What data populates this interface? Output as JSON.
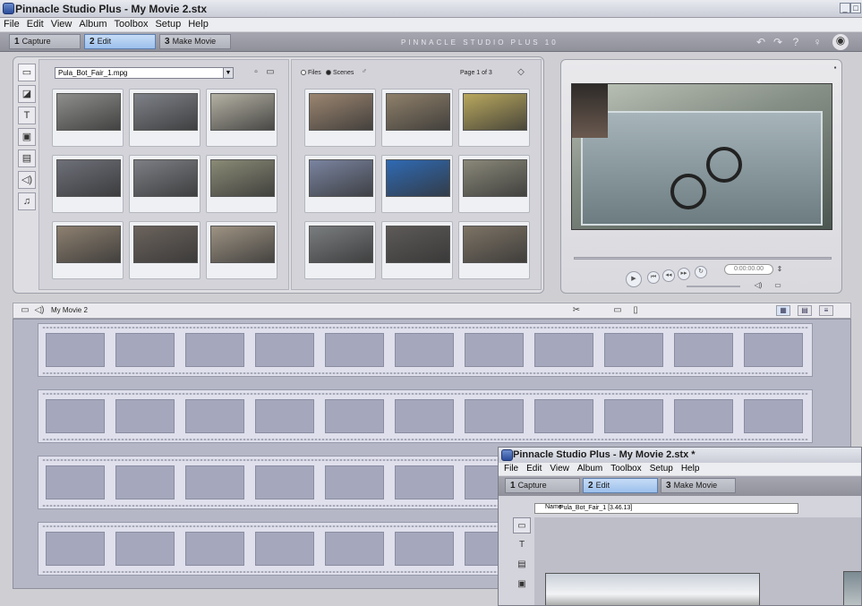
{
  "window": {
    "title": "Pinnacle Studio Plus - My Movie 2.stx",
    "menu": [
      "File",
      "Edit",
      "View",
      "Album",
      "Toolbox",
      "Setup",
      "Help"
    ],
    "tabs": [
      {
        "num": "1",
        "label": "Capture"
      },
      {
        "num": "2",
        "label": "Edit"
      },
      {
        "num": "3",
        "label": "Make Movie"
      }
    ],
    "brand": "PINNACLE STUDIO PLUS 10",
    "header_icons": [
      "undo-icon",
      "redo-icon",
      "help-icon",
      "hint-icon",
      "premium-icon"
    ]
  },
  "album": {
    "source_file": "Pula_Bot_Fair_1.mpg",
    "view_options": {
      "files": "Files",
      "scenes": "Scenes",
      "selected": "scenes"
    },
    "page": "Page 1 of 3",
    "tools": [
      "video-scenes-icon",
      "transitions-icon",
      "titles-icon",
      "photos-icon",
      "disc-menus-icon",
      "sound-effects-icon",
      "music-icon"
    ],
    "left_thumbnails": [
      {
        "color": "#8e8f8c"
      },
      {
        "color": "#7e8188"
      },
      {
        "color": "#b4b1a3"
      },
      {
        "color": "#6e7079"
      },
      {
        "color": "#7c7e84"
      },
      {
        "color": "#8a8a76"
      },
      {
        "color": "#8d8070"
      },
      {
        "color": "#6b635d"
      },
      {
        "color": "#9e9383"
      }
    ],
    "right_thumbnails": [
      {
        "color": "#9b8570"
      },
      {
        "color": "#8f806a"
      },
      {
        "color": "#b9a85e"
      },
      {
        "color": "#7a84a0"
      },
      {
        "color": "#2f6ab4"
      },
      {
        "color": "#8a8879"
      },
      {
        "color": "#7a7d7f"
      },
      {
        "color": "#5d5a58"
      },
      {
        "color": "#7d7365"
      }
    ]
  },
  "preview": {
    "timecode": "0:00:00.00"
  },
  "movie": {
    "title": "My Movie 2",
    "strips": 4,
    "cells_per_strip": 11
  },
  "second_window": {
    "title": "Pinnacle Studio Plus - My Movie 2.stx *",
    "menu": [
      "File",
      "Edit",
      "View",
      "Album",
      "Toolbox",
      "Setup",
      "Help"
    ],
    "tabs": [
      {
        "num": "1",
        "label": "Capture"
      },
      {
        "num": "2",
        "label": "Edit"
      },
      {
        "num": "3",
        "label": "Make Movie"
      }
    ],
    "name_label": "Name",
    "name_value": "Pula_Bot_Fair_1 [3.46.13]"
  }
}
